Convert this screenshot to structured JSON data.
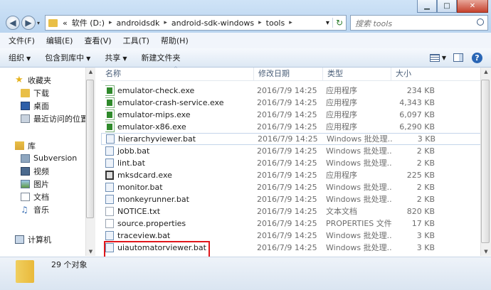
{
  "window": {
    "controls": {
      "minimize": "▁",
      "maximize": "□",
      "close": "✕"
    }
  },
  "address": {
    "overflow": "«",
    "crumbs": [
      "软件 (D:)",
      "androidsdk",
      "android-sdk-windows",
      "tools"
    ],
    "dropdown": "▾",
    "refresh": "↻"
  },
  "search": {
    "placeholder": "搜索 tools"
  },
  "menubar": [
    "文件(F)",
    "编辑(E)",
    "查看(V)",
    "工具(T)",
    "帮助(H)"
  ],
  "toolbar": {
    "organize": "组织",
    "include": "包含到库中",
    "share": "共享",
    "new_folder": "新建文件夹",
    "help": "?"
  },
  "nav": {
    "favorites": "收藏夹",
    "downloads": "下载",
    "desktop": "桌面",
    "recent": "最近访问的位置",
    "libraries": "库",
    "subversion": "Subversion",
    "videos": "视频",
    "pictures": "图片",
    "documents": "文档",
    "music": "音乐",
    "computer": "计算机"
  },
  "columns": {
    "name": "名称",
    "date": "修改日期",
    "type": "类型",
    "size": "大小"
  },
  "files": [
    {
      "name": "emulator-check.exe",
      "date": "2016/7/9 14:25",
      "type": "应用程序",
      "size": "234 KB",
      "icon": "exe-icon"
    },
    {
      "name": "emulator-crash-service.exe",
      "date": "2016/7/9 14:25",
      "type": "应用程序",
      "size": "4,343 KB",
      "icon": "exe-icon"
    },
    {
      "name": "emulator-mips.exe",
      "date": "2016/7/9 14:25",
      "type": "应用程序",
      "size": "6,097 KB",
      "icon": "exe-icon"
    },
    {
      "name": "emulator-x86.exe",
      "date": "2016/7/9 14:25",
      "type": "应用程序",
      "size": "6,290 KB",
      "icon": "exe-icon"
    },
    {
      "name": "hierarchyviewer.bat",
      "date": "2016/7/9 14:25",
      "type": "Windows 批处理...",
      "size": "3 KB",
      "icon": "bat-icon"
    },
    {
      "name": "jobb.bat",
      "date": "2016/7/9 14:25",
      "type": "Windows 批处理...",
      "size": "2 KB",
      "icon": "bat-icon"
    },
    {
      "name": "lint.bat",
      "date": "2016/7/9 14:25",
      "type": "Windows 批处理...",
      "size": "2 KB",
      "icon": "bat-icon"
    },
    {
      "name": "mksdcard.exe",
      "date": "2016/7/9 14:25",
      "type": "应用程序",
      "size": "225 KB",
      "icon": "mksdcard-icon"
    },
    {
      "name": "monitor.bat",
      "date": "2016/7/9 14:25",
      "type": "Windows 批处理...",
      "size": "2 KB",
      "icon": "bat-icon"
    },
    {
      "name": "monkeyrunner.bat",
      "date": "2016/7/9 14:25",
      "type": "Windows 批处理...",
      "size": "2 KB",
      "icon": "bat-icon"
    },
    {
      "name": "NOTICE.txt",
      "date": "2016/7/9 14:25",
      "type": "文本文档",
      "size": "820 KB",
      "icon": "text-file-icon"
    },
    {
      "name": "source.properties",
      "date": "2016/7/9 14:25",
      "type": "PROPERTIES 文件",
      "size": "17 KB",
      "icon": "file-icon"
    },
    {
      "name": "traceview.bat",
      "date": "2016/7/9 14:25",
      "type": "Windows 批处理...",
      "size": "3 KB",
      "icon": "bat-icon"
    },
    {
      "name": "uiautomatorviewer.bat",
      "date": "2016/7/9 14:25",
      "type": "Windows 批处理...",
      "size": "3 KB",
      "icon": "bat-icon"
    }
  ],
  "status": {
    "count": "29 个对象"
  },
  "colors": {
    "highlight_box": "#e0161b",
    "row_hover_border": "#c4d5ea"
  }
}
